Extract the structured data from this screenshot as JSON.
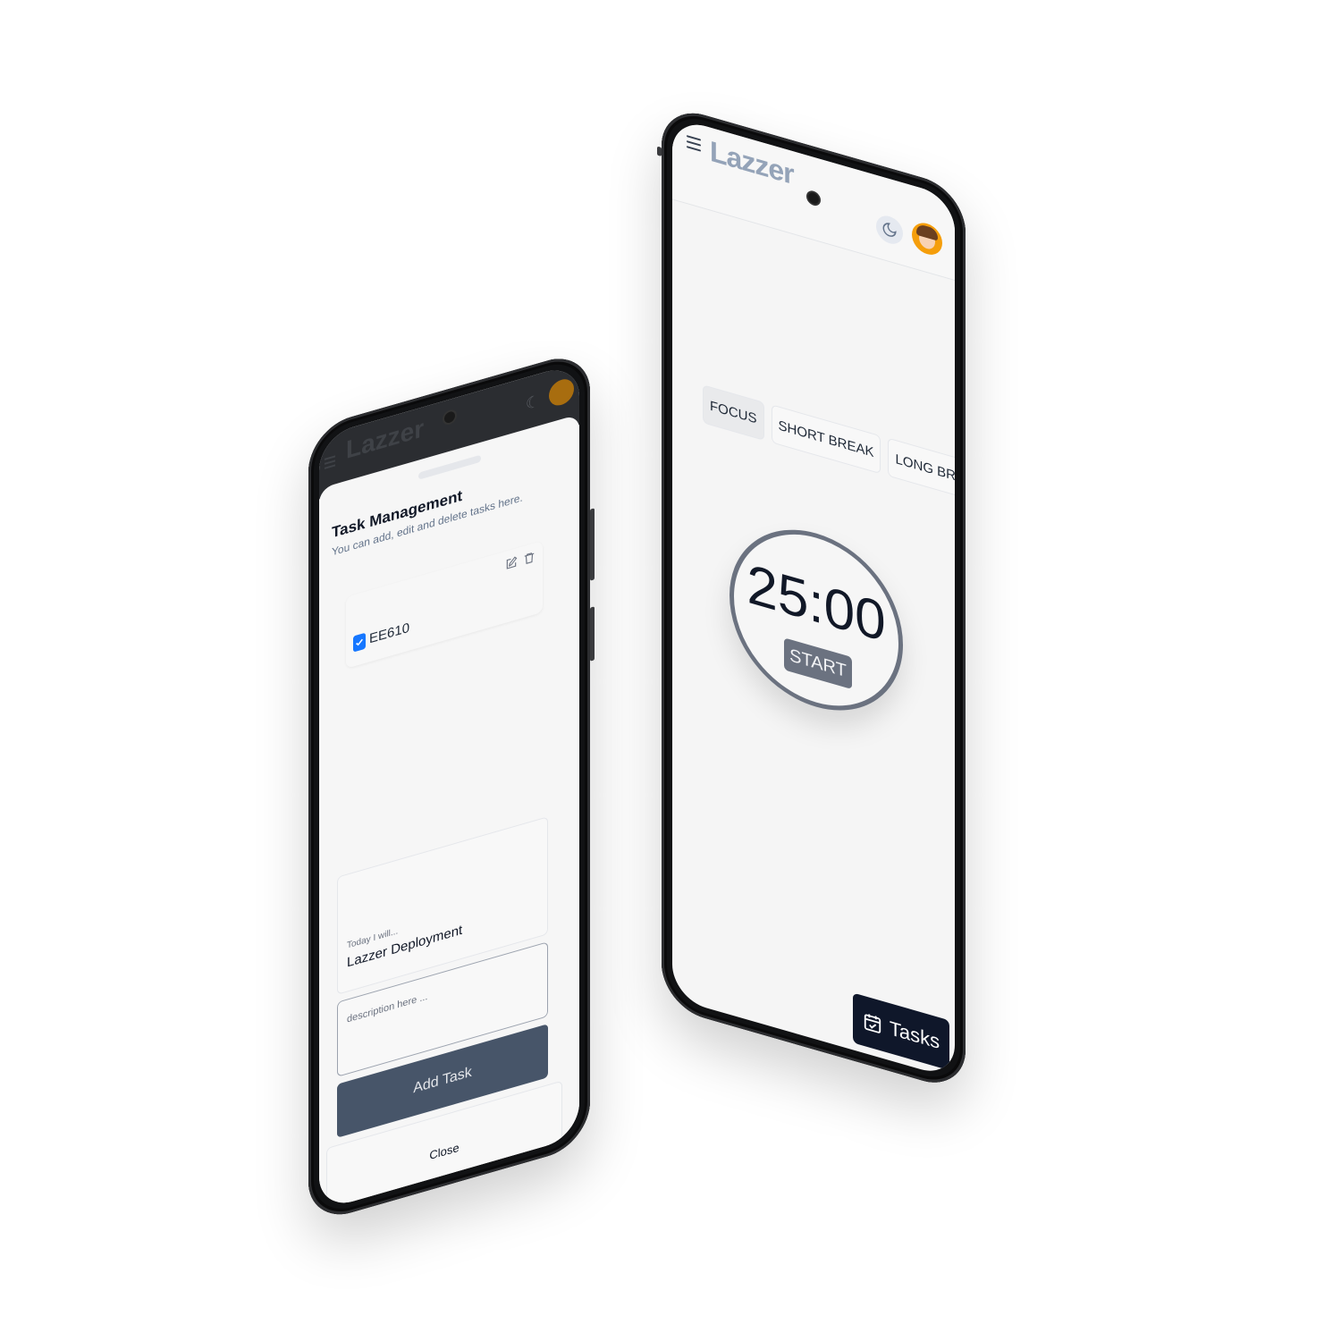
{
  "timer_screen": {
    "logo": "Lazzer",
    "modes": [
      "FOCUS",
      "SHORT BREAK",
      "LONG BREAK"
    ],
    "active_mode": "FOCUS",
    "timer": "25:00",
    "start_label": "START",
    "tasks_label": "Tasks"
  },
  "task_screen": {
    "logo": "Lazzer",
    "title": "Task Management",
    "description": "You can add, edit and delete tasks here.",
    "tasks": [
      {
        "name": "EE610",
        "done": true
      }
    ],
    "field_label": "Today I will...",
    "field_value": "Lazzer Deployment",
    "description_placeholder": "description here ...",
    "add_label": "Add Task",
    "close_label": "Close"
  },
  "colors": {
    "accent": "#0f172a",
    "primary_button": "#475569",
    "timer_ring": "#6b7280",
    "checkbox": "#1677ff"
  }
}
